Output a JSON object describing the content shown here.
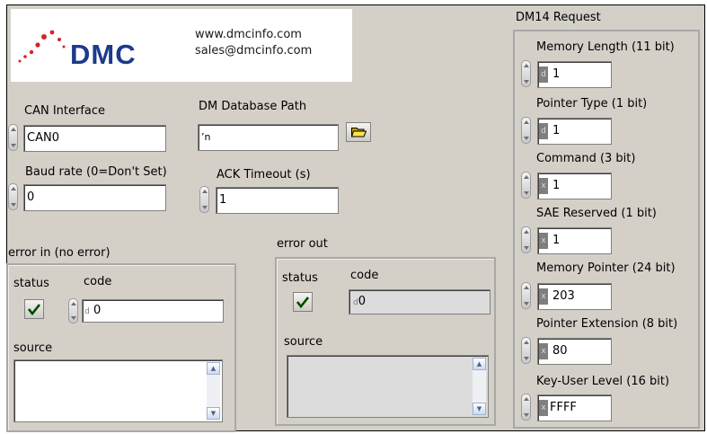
{
  "logo": {
    "brand": "DMC",
    "website": "www.dmcinfo.com",
    "email": "sales@dmcinfo.com",
    "brand_color": "#1c3a8c",
    "accent_color": "#d2232a"
  },
  "can_interface": {
    "label": "CAN Interface",
    "value": "CAN0"
  },
  "dm_database_path": {
    "label": "DM Database Path",
    "prefix": "ʼn",
    "value": ""
  },
  "baud_rate": {
    "label": "Baud rate (0=Don't Set)",
    "value": "0"
  },
  "ack_timeout": {
    "label": "ACK Timeout (s)",
    "value": "1"
  },
  "error_in": {
    "title": "error in (no error)",
    "status_label": "status",
    "code_label": "code",
    "code_radix": "d",
    "code_value": "0",
    "source_label": "source",
    "source_value": ""
  },
  "error_out": {
    "title": "error out",
    "status_label": "status",
    "code_label": "code",
    "code_radix": "d",
    "code_value": "0",
    "source_label": "source",
    "source_value": ""
  },
  "dm14": {
    "title": "DM14 Request",
    "fields": [
      {
        "label": "Memory Length (11 bit)",
        "radix": "d",
        "value": "1"
      },
      {
        "label": "Pointer Type (1 bit)",
        "radix": "d",
        "value": "1"
      },
      {
        "label": "Command (3 bit)",
        "radix": "x",
        "value": "1"
      },
      {
        "label": "SAE Reserved (1 bit)",
        "radix": "x",
        "value": "1"
      },
      {
        "label": "Memory Pointer (24 bit)",
        "radix": "x",
        "value": "203"
      },
      {
        "label": "Pointer Extension (8 bit)",
        "radix": "x",
        "value": "80"
      },
      {
        "label": "Key-User Level (16 bit)",
        "radix": "x",
        "value": "FFFF"
      }
    ]
  },
  "icons": {
    "folder": "folder-open-icon",
    "check": "checkmark-icon"
  }
}
